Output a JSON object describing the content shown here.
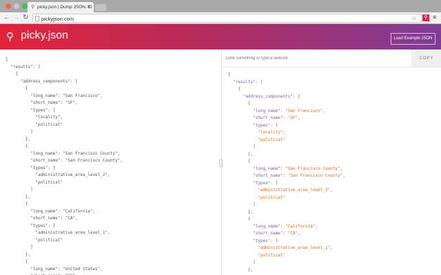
{
  "browser": {
    "tab_title": "picky.json | Dump JSON. Cl",
    "url": "pickyjson.com"
  },
  "app": {
    "title": "picky.json",
    "load_button": "Load Example JSON",
    "selector_placeholder": "Click something or type a selector",
    "copy_button": "COPY"
  },
  "colors": {
    "header_start": "#e3233a",
    "header_end": "#7f3d98",
    "key": "#7b5ea7",
    "string": "#e2691d"
  },
  "left_lines": [
    [
      0,
      "{"
    ],
    [
      1,
      "\"results\": ["
    ],
    [
      2,
      "{"
    ],
    [
      3,
      "\"address_components\": ["
    ],
    [
      4,
      "{"
    ],
    [
      5,
      "\"long_name\": ",
      "\"San Francisco\"",
      ","
    ],
    [
      5,
      "\"short_name\": ",
      "\"SF\"",
      ","
    ],
    [
      5,
      "\"types\": ["
    ],
    [
      6,
      "",
      "\"locality\"",
      ","
    ],
    [
      6,
      "",
      "\"political\""
    ],
    [
      5,
      "]"
    ],
    [
      4,
      "},"
    ],
    [
      4,
      "{"
    ],
    [
      5,
      "\"long_name\": ",
      "\"San Francisco County\"",
      ","
    ],
    [
      5,
      "\"short_name\": ",
      "\"San Francisco County\"",
      ","
    ],
    [
      5,
      "\"types\": ["
    ],
    [
      6,
      "",
      "\"administrative_area_level_2\"",
      ","
    ],
    [
      6,
      "",
      "\"political\""
    ],
    [
      5,
      "]"
    ],
    [
      4,
      "},"
    ],
    [
      4,
      "{"
    ],
    [
      5,
      "\"long_name\": ",
      "\"California\"",
      ","
    ],
    [
      5,
      "\"short_name\": ",
      "\"CA\"",
      ","
    ],
    [
      5,
      "\"types\": ["
    ],
    [
      6,
      "",
      "\"administrative_area_level_1\"",
      ","
    ],
    [
      6,
      "",
      "\"political\""
    ],
    [
      5,
      "]"
    ],
    [
      4,
      "},"
    ],
    [
      4,
      "{"
    ],
    [
      5,
      "\"long_name\": ",
      "\"United States\"",
      ","
    ],
    [
      5,
      "\"short_name\": ",
      "\"US\"",
      ","
    ]
  ],
  "right_lines": [
    [
      0,
      "{"
    ],
    [
      1,
      "\"results\": ["
    ],
    [
      2,
      "{"
    ],
    [
      3,
      "\"address_components\": ["
    ],
    [
      4,
      "{"
    ],
    [
      5,
      "\"long_name\": ",
      "\"San Francisco\"",
      ","
    ],
    [
      5,
      "\"short_name\": ",
      "\"SF\"",
      ","
    ],
    [
      5,
      "\"types\": ["
    ],
    [
      6,
      "",
      "\"locality\"",
      ","
    ],
    [
      6,
      "",
      "\"political\""
    ],
    [
      5,
      "]"
    ],
    [
      4,
      "},"
    ],
    [
      4,
      "{"
    ],
    [
      5,
      "\"long_name\": ",
      "\"San Francisco County\"",
      ","
    ],
    [
      5,
      "\"short_name\": ",
      "\"San Francisco County\"",
      ","
    ],
    [
      5,
      "\"types\": ["
    ],
    [
      6,
      "",
      "\"administrative_area_level_2\"",
      ","
    ],
    [
      6,
      "",
      "\"political\""
    ],
    [
      5,
      "]"
    ],
    [
      4,
      "},"
    ],
    [
      4,
      "{"
    ],
    [
      5,
      "\"long_name\": ",
      "\"California\"",
      ","
    ],
    [
      5,
      "\"short_name\": ",
      "\"CA\"",
      ","
    ],
    [
      5,
      "\"types\": ["
    ],
    [
      6,
      "",
      "\"administrative_area_level_1\"",
      ","
    ],
    [
      6,
      "",
      "\"political\""
    ],
    [
      5,
      "]"
    ],
    [
      4,
      "},"
    ]
  ]
}
